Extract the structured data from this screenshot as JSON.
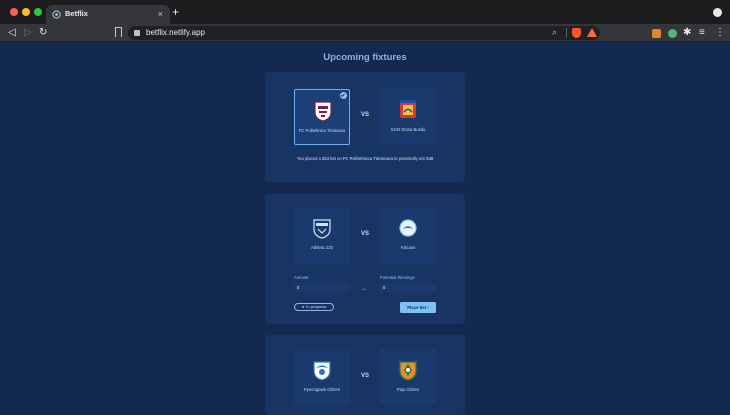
{
  "browser": {
    "tab_title": "Betflix",
    "tab_close": "×",
    "new_tab": "+",
    "url": "betflix.netlify.app",
    "nav": {
      "back": "◁",
      "forward": "▷",
      "reload": "↻"
    },
    "omni_search_icon": "⌕",
    "ext_puzzle": "✱",
    "ext_list": "≡",
    "menu": "⋮"
  },
  "page": {
    "title": "Upcoming fixtures",
    "fixtures": [
      {
        "home": "FC Politehnica Timisoara",
        "away": "SCM Gloria Buzău",
        "vs": "VS",
        "selected": "home",
        "bet_note": {
          "prefix": "You placed a ",
          "amount": "$24",
          "mid1": " bet on ",
          "team": "FC Politehnica Timisoara",
          "mid2": " to potentially win ",
          "winnings": "$48"
        }
      },
      {
        "home": "Athletic 220",
        "away": "Falcons",
        "vs": "VS",
        "amount_label": "Amount",
        "amount_value": "0",
        "winnings_label": "Potential Winnings",
        "winnings_value": "0",
        "arrow": "→",
        "status": "In progress",
        "place_bet": "Place bet ›"
      },
      {
        "home": "Pyeongtaek Citizen",
        "away": "Paju Citizen",
        "vs": "VS"
      }
    ]
  },
  "colors": {
    "background": "#13294f",
    "card": "#183463",
    "accent": "#7fc1f4",
    "title": "#8fb2ea"
  }
}
